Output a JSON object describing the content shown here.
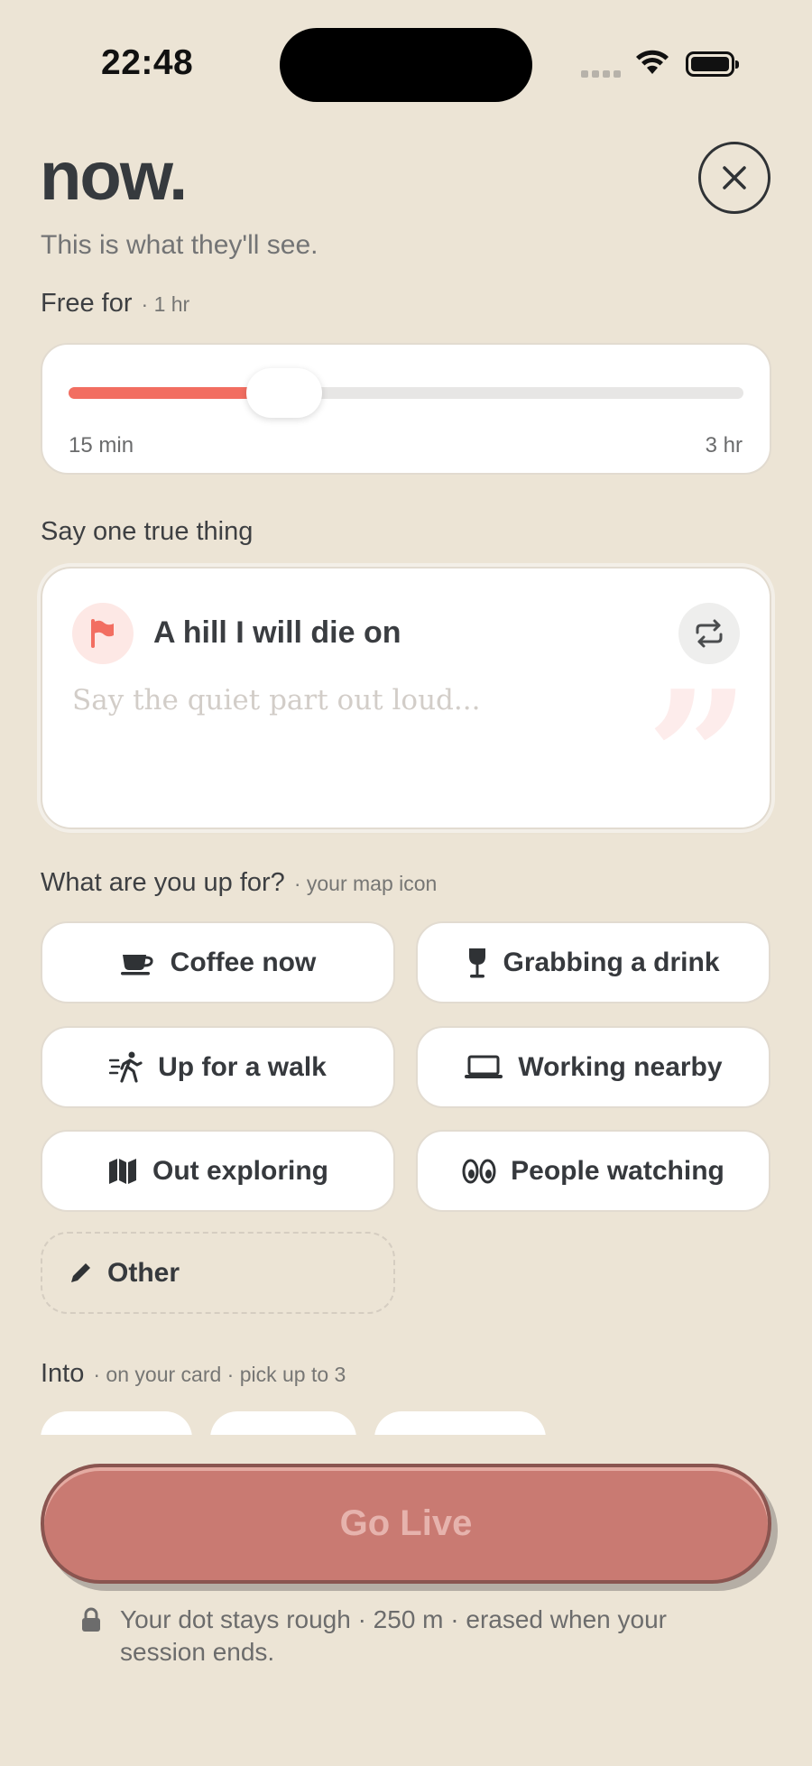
{
  "status_bar": {
    "time": "22:48"
  },
  "header": {
    "title": "now.",
    "subtitle": "This is what they'll see."
  },
  "free_for": {
    "label": "Free for",
    "note": "· 1 hr",
    "slider_min": "15 min",
    "slider_max": "3 hr",
    "slider_value_fraction": 0.32
  },
  "true_thing": {
    "label": "Say one true thing",
    "prompt": "A hill I will die on",
    "placeholder": "Say the quiet part out loud...",
    "quote_glyph": "”"
  },
  "up_for": {
    "label": "What are you up for?",
    "note": "· your map icon",
    "options": [
      {
        "label": "Coffee now",
        "icon": "coffee-cup-icon"
      },
      {
        "label": "Grabbing a drink",
        "icon": "wine-glass-icon"
      },
      {
        "label": "Up for a walk",
        "icon": "walking-person-icon"
      },
      {
        "label": "Working nearby",
        "icon": "laptop-icon"
      },
      {
        "label": "Out exploring",
        "icon": "map-icon"
      },
      {
        "label": "People watching",
        "icon": "eyes-icon"
      },
      {
        "label": "Other",
        "icon": "pencil-icon"
      }
    ]
  },
  "into": {
    "label": "Into",
    "note": "· on your card · pick up to 3"
  },
  "go_live": {
    "label": "Go Live",
    "footnote": "Your dot stays rough · 250 m · erased when your session ends.",
    "footnote_icon": "lock-icon"
  },
  "colors": {
    "background": "#ece4d5",
    "accent": "#f26e61",
    "go_live_button": "#c97a72"
  }
}
